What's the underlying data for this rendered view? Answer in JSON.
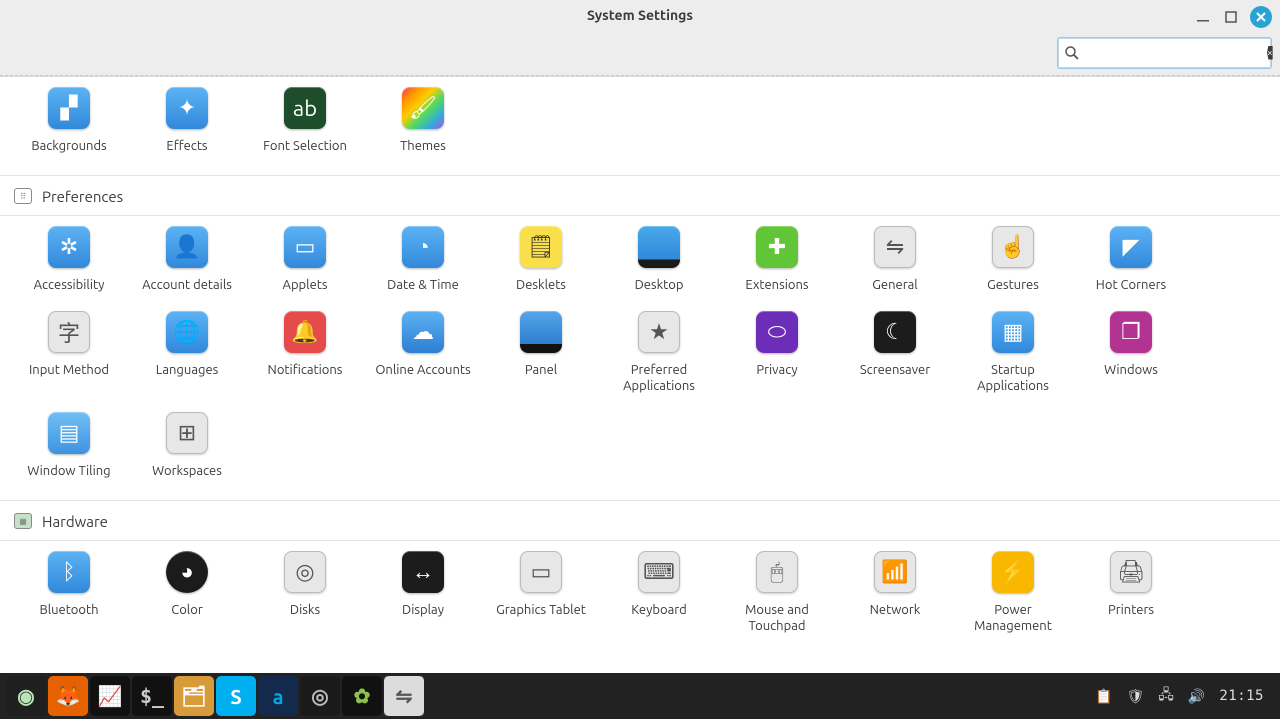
{
  "window": {
    "title": "System Settings"
  },
  "search": {
    "value": "",
    "placeholder": ""
  },
  "sections": {
    "appearance": {
      "items": [
        {
          "label": "Backgrounds",
          "icon": "image-icon",
          "class": "bg-blue-grad",
          "glyph": "▞"
        },
        {
          "label": "Effects",
          "icon": "wand-icon",
          "class": "bg-blue-grad",
          "glyph": "✦"
        },
        {
          "label": "Font Selection",
          "icon": "font-icon",
          "class": "bg-darkgreen",
          "glyph": "ab"
        },
        {
          "label": "Themes",
          "icon": "brush-icon",
          "class": "bg-rainbow",
          "glyph": "🖌"
        }
      ]
    },
    "preferences": {
      "title": "Preferences",
      "items": [
        {
          "label": "Accessibility",
          "icon": "accessibility-icon",
          "class": "bg-blue-grad",
          "glyph": "✲"
        },
        {
          "label": "Account details",
          "icon": "user-icon",
          "class": "bg-blue-grad",
          "glyph": "👤"
        },
        {
          "label": "Applets",
          "icon": "applets-icon",
          "class": "bg-blue-grad",
          "glyph": "▭"
        },
        {
          "label": "Date & Time",
          "icon": "clock-icon",
          "class": "bg-blue-grad",
          "glyph": "◔"
        },
        {
          "label": "Desklets",
          "icon": "note-icon",
          "class": "bg-yellow",
          "glyph": "🗒"
        },
        {
          "label": "Desktop",
          "icon": "desktop-icon",
          "class": "bg-desk",
          "glyph": ""
        },
        {
          "label": "Extensions",
          "icon": "puzzle-icon",
          "class": "bg-green",
          "glyph": "✚"
        },
        {
          "label": "General",
          "icon": "toggle-icon",
          "class": "bg-lightgray",
          "glyph": "⇋"
        },
        {
          "label": "Gestures",
          "icon": "touch-icon",
          "class": "bg-lightgray",
          "glyph": "☝"
        },
        {
          "label": "Hot Corners",
          "icon": "corner-icon",
          "class": "bg-blue-grad",
          "glyph": "◤"
        },
        {
          "label": "Input Method",
          "icon": "input-icon",
          "class": "bg-lightgray",
          "glyph": "字"
        },
        {
          "label": "Languages",
          "icon": "globe-icon",
          "class": "bg-blue-grad",
          "glyph": "🌐"
        },
        {
          "label": "Notifications",
          "icon": "bell-icon",
          "class": "bg-red",
          "glyph": "🔔"
        },
        {
          "label": "Online Accounts",
          "icon": "cloud-icon",
          "class": "bg-cloud",
          "glyph": "☁"
        },
        {
          "label": "Panel",
          "icon": "panel-icon",
          "class": "bg-panel",
          "glyph": ""
        },
        {
          "label": "Preferred Applications",
          "icon": "star-icon",
          "class": "bg-lightgray",
          "glyph": "★"
        },
        {
          "label": "Privacy",
          "icon": "mask-icon",
          "class": "bg-purple",
          "glyph": "⬭"
        },
        {
          "label": "Screensaver",
          "icon": "moon-icon",
          "class": "bg-dark",
          "glyph": "☾"
        },
        {
          "label": "Startup Applications",
          "icon": "startup-icon",
          "class": "bg-blue-grad",
          "glyph": "▦"
        },
        {
          "label": "Windows",
          "icon": "windows-icon",
          "class": "bg-magenta",
          "glyph": "❐"
        },
        {
          "label": "Window Tiling",
          "icon": "tiling-icon",
          "class": "bg-tile",
          "glyph": "▤"
        },
        {
          "label": "Workspaces",
          "icon": "workspaces-icon",
          "class": "bg-lightgray",
          "glyph": "⊞"
        }
      ]
    },
    "hardware": {
      "title": "Hardware",
      "items": [
        {
          "label": "Bluetooth",
          "icon": "bluetooth-icon",
          "class": "bg-blue-grad",
          "glyph": "ᛒ"
        },
        {
          "label": "Color",
          "icon": "color-icon",
          "class": "bg-black-circle",
          "glyph": "◕"
        },
        {
          "label": "Disks",
          "icon": "disk-icon",
          "class": "bg-lightgray",
          "glyph": "◎"
        },
        {
          "label": "Display",
          "icon": "display-icon",
          "class": "bg-dark",
          "glyph": "↔"
        },
        {
          "label": "Graphics Tablet",
          "icon": "tablet-icon",
          "class": "bg-lightgray",
          "glyph": "▭"
        },
        {
          "label": "Keyboard",
          "icon": "keyboard-icon",
          "class": "bg-lightgray",
          "glyph": "⌨"
        },
        {
          "label": "Mouse and Touchpad",
          "icon": "mouse-icon",
          "class": "bg-lightgray",
          "glyph": "🖱"
        },
        {
          "label": "Network",
          "icon": "wifi-icon",
          "class": "bg-lightgray",
          "glyph": "📶"
        },
        {
          "label": "Power Management",
          "icon": "power-icon",
          "class": "bg-orange",
          "glyph": "⚡"
        },
        {
          "label": "Printers",
          "icon": "printer-icon",
          "class": "bg-lightgray",
          "glyph": "🖨"
        }
      ]
    }
  },
  "taskbar": {
    "items": [
      {
        "name": "menu",
        "glyph": "◉",
        "bg": "#1f1f1f",
        "color": "#b8e6b8"
      },
      {
        "name": "firefox",
        "glyph": "🦊",
        "bg": "#e66100",
        "color": "#fff"
      },
      {
        "name": "monitor",
        "glyph": "📈",
        "bg": "#111",
        "color": "#4caf50"
      },
      {
        "name": "terminal",
        "glyph": "$_",
        "bg": "#111",
        "color": "#ccc"
      },
      {
        "name": "files",
        "glyph": "🗂",
        "bg": "#d89b3a",
        "color": "#fff"
      },
      {
        "name": "skype",
        "glyph": "S",
        "bg": "#00aff0",
        "color": "#fff"
      },
      {
        "name": "amazon",
        "glyph": "a",
        "bg": "#132a4c",
        "color": "#00a8e1"
      },
      {
        "name": "obs",
        "glyph": "◎",
        "bg": "#1a1a1a",
        "color": "#bbb"
      },
      {
        "name": "pinwheel",
        "glyph": "✿",
        "bg": "#111",
        "color": "#8bc34a"
      },
      {
        "name": "settings",
        "glyph": "⇋",
        "bg": "#dcdcdc",
        "color": "#555",
        "active": true
      }
    ],
    "clock": "21:15"
  }
}
